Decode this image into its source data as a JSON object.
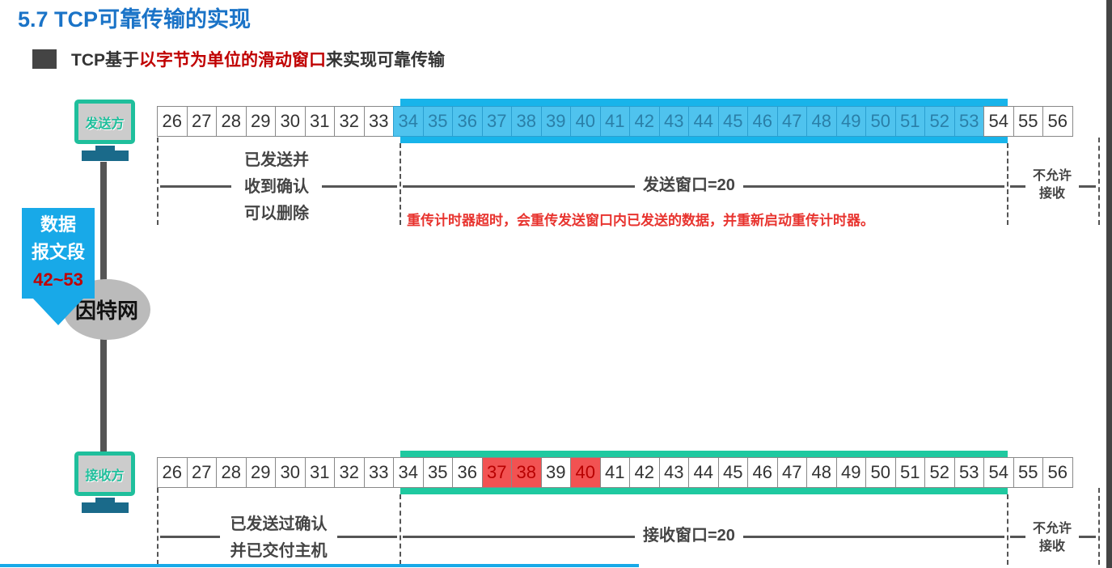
{
  "title": "5.7 TCP可靠传输的实现",
  "subtitle": {
    "pre": "TCP基于",
    "highlight": "以字节为单位的滑动窗口",
    "post": "来实现可靠传输"
  },
  "sender": {
    "label": "发送方",
    "cells": [
      26,
      27,
      28,
      29,
      30,
      31,
      32,
      33,
      34,
      35,
      36,
      37,
      38,
      39,
      40,
      41,
      42,
      43,
      44,
      45,
      46,
      47,
      48,
      49,
      50,
      51,
      52,
      53,
      54,
      55,
      56
    ],
    "window_start": 34,
    "window_end": 53,
    "window_color": "#18b4ea",
    "left_label": [
      "已发送并",
      "收到确认",
      "可以删除"
    ],
    "window_label": "发送窗口=20",
    "right_label": [
      "不允许",
      "接收"
    ],
    "note": "重传计时器超时，会重传发送窗口内已发送的数据，并重新启动重传计时器。"
  },
  "segment": {
    "line1": "数据",
    "line2": "报文段",
    "range": "42~53"
  },
  "internet": "因特网",
  "receiver": {
    "label": "接收方",
    "cells": [
      26,
      27,
      28,
      29,
      30,
      31,
      32,
      33,
      34,
      35,
      36,
      37,
      38,
      39,
      40,
      41,
      42,
      43,
      44,
      45,
      46,
      47,
      48,
      49,
      50,
      51,
      52,
      53,
      54,
      55,
      56
    ],
    "window_start": 34,
    "window_end": 53,
    "window_color": "#1fc9a0",
    "received": [
      37,
      38,
      40
    ],
    "received_color": "#f25252",
    "left_label": [
      "已发送过确认",
      "并已交付主机"
    ],
    "window_label": "接收窗口=20",
    "right_label": [
      "不允许",
      "接收"
    ]
  }
}
